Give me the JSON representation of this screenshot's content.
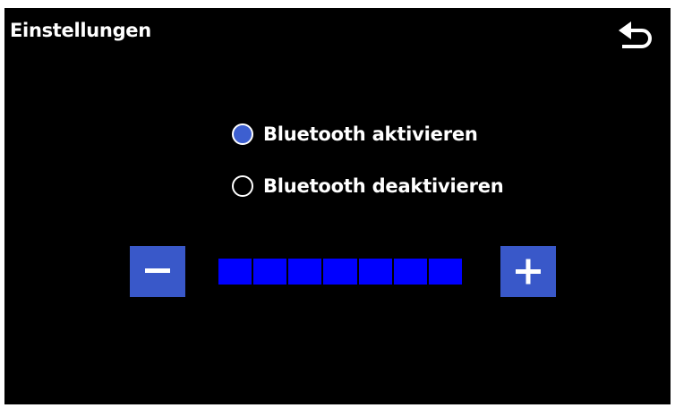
{
  "header": {
    "title": "Einstellungen",
    "back_icon": "back-arrow-icon"
  },
  "bluetooth": {
    "options": [
      {
        "label": "Bluetooth aktivieren",
        "selected": true
      },
      {
        "label": "Bluetooth deaktivieren",
        "selected": false
      }
    ]
  },
  "level": {
    "segments_total": 7,
    "segments_filled": 7,
    "fraction": 1.0,
    "decrease_icon": "minus-icon",
    "increase_icon": "plus-icon"
  },
  "colors": {
    "background": "#000000",
    "text": "#ffffff",
    "button": "#3958c9",
    "radio_checked": "#3d5fd0",
    "segment_on": "#0000ff"
  }
}
